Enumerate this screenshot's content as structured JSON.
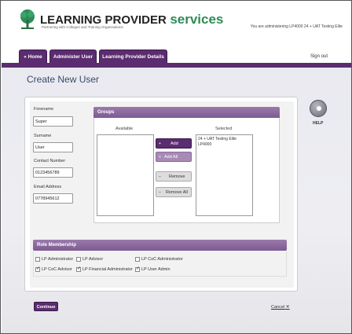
{
  "header": {
    "brand_part1": "LEARNING PROVIDER",
    "brand_part2": "services",
    "tagline": "Partnering with Colleges and Training Organisations",
    "user_info": "You are administering LP4000 24 + UAT Testing Elite"
  },
  "nav": {
    "tabs": [
      {
        "label": "« Home"
      },
      {
        "label": "Administer User"
      },
      {
        "label": "Learning Provider Details"
      }
    ],
    "signout_label": "Sign out"
  },
  "page": {
    "title": "Create New User",
    "help_label": "HELP"
  },
  "form": {
    "forename": {
      "label": "Forename",
      "value": "Super"
    },
    "surname": {
      "label": "Surname",
      "value": "User"
    },
    "contact": {
      "label": "Contact Number",
      "value": "0123456789"
    },
    "email": {
      "label": "Email Address",
      "value": "0778945612"
    }
  },
  "groups": {
    "title": "Groups",
    "available_label": "Available",
    "selected_label": "Selected",
    "available_items": [],
    "selected_items": [
      "24 + UAT Testing Elite",
      "LP4000"
    ],
    "buttons": {
      "add": "Add",
      "add_all": "Add All",
      "remove": "Remove",
      "remove_all": "Remove All"
    }
  },
  "roles": {
    "title": "Role Membership",
    "items": [
      {
        "label": "LP Administrator",
        "checked": false
      },
      {
        "label": "LP Advisor",
        "checked": false
      },
      {
        "label": "LP CoC Administrator",
        "checked": false
      },
      {
        "label": "LP CoC Advisor",
        "checked": true
      },
      {
        "label": "LP Financial Administrator",
        "checked": true
      },
      {
        "label": "LP User Admin",
        "checked": true
      }
    ]
  },
  "actions": {
    "continue_label": "Continue",
    "cancel_label": "Cancel"
  },
  "colors": {
    "accent": "#5b2c6f",
    "brand_green": "#2e8b57"
  }
}
